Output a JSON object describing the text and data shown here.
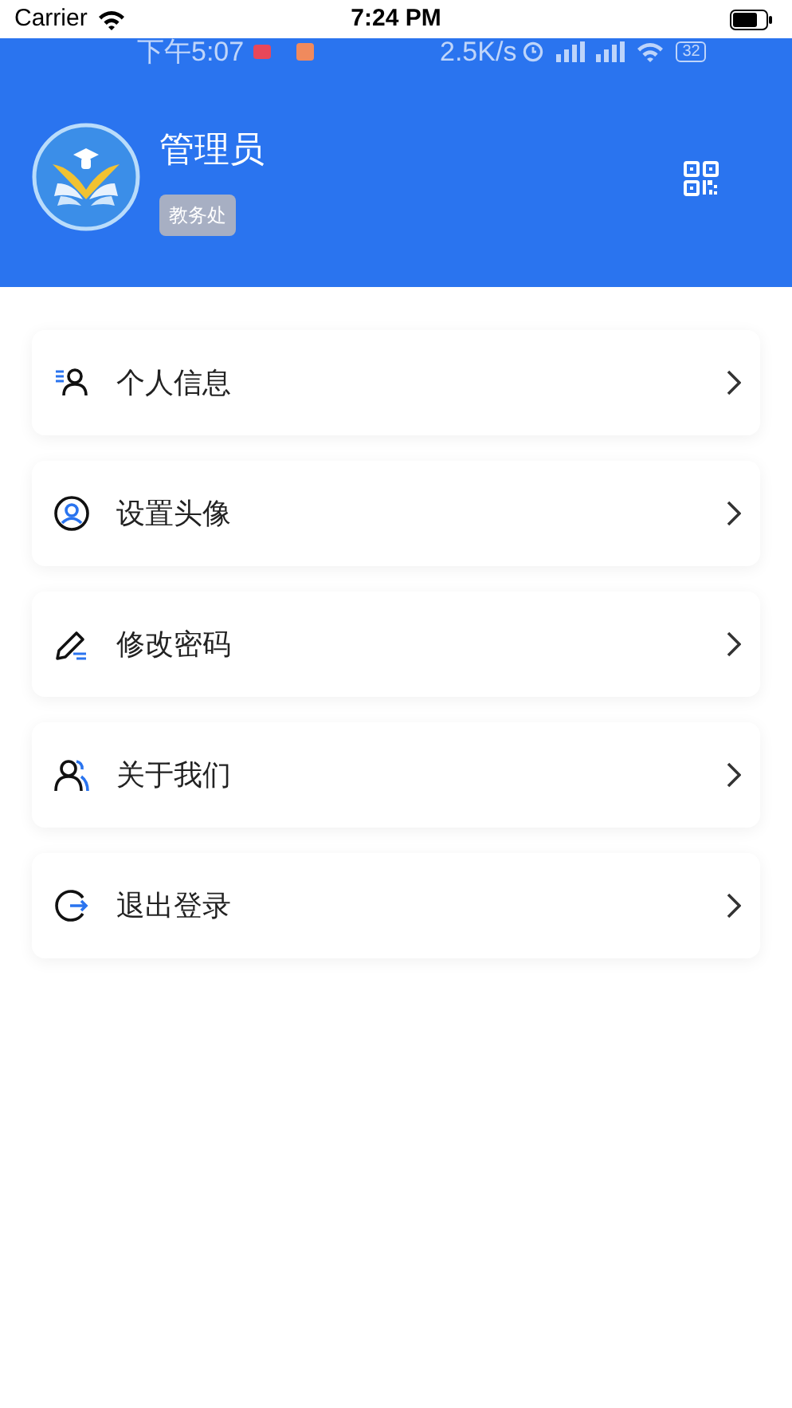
{
  "status_bar": {
    "carrier": "Carrier",
    "time": "7:24 PM"
  },
  "inner_status_bar": {
    "time": "下午5:07",
    "speed": "2.5K/s",
    "battery": "32"
  },
  "profile": {
    "name": "管理员",
    "department": "教务处"
  },
  "menu": [
    {
      "kind": "info",
      "label": "个人信息"
    },
    {
      "kind": "avatar",
      "label": "设置头像"
    },
    {
      "kind": "password",
      "label": "修改密码"
    },
    {
      "kind": "about",
      "label": "关于我们"
    },
    {
      "kind": "logout",
      "label": "退出登录"
    }
  ]
}
